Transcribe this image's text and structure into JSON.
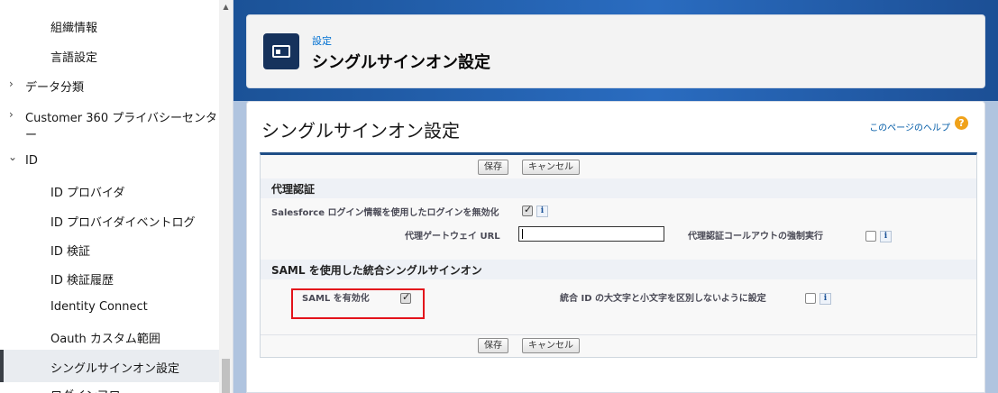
{
  "sidebar": {
    "items": [
      {
        "label": "組織情報"
      },
      {
        "label": "言語設定"
      },
      {
        "label": "データ分類",
        "chevron": "›"
      },
      {
        "label": "Customer 360 プライバシーセンタ",
        "label2": "ー",
        "chevron": "›"
      },
      {
        "label": "ID",
        "chevron": "⌄"
      },
      {
        "label": "ID プロバイダ"
      },
      {
        "label": "ID プロバイダイベントログ"
      },
      {
        "label": "ID 検証"
      },
      {
        "label": "ID 検証履歴"
      },
      {
        "label": "Identity Connect"
      },
      {
        "label": "Oauth カスタム範囲"
      },
      {
        "label": "シングルサインオン設定"
      },
      {
        "label": "ログインフロー"
      }
    ],
    "active_item": "シングルサインオン設定"
  },
  "header": {
    "breadcrumb": "設定",
    "title": "シングルサインオン設定",
    "icon": "id-card-icon"
  },
  "main": {
    "page_title": "シングルサインオン設定",
    "help_link": "このページのヘルプ",
    "help_icon": "?",
    "buttons": {
      "save": "保存",
      "cancel": "キャンセル"
    },
    "delegated": {
      "section_title": "代理認証",
      "disable_login_label": "Salesforce ログイン情報を使用したログインを無効化",
      "disable_login_checked": true,
      "gateway_url_label": "代理ゲートウェイ URL",
      "gateway_url_value": "",
      "force_callout_label": "代理認証コールアウトの強制実行",
      "force_callout_checked": false
    },
    "saml": {
      "section_title": "SAML を使用した統合シングルサインオン",
      "enable_label": "SAML を有効化",
      "enable_checked": true,
      "case_insensitive_label": "統合 ID の大文字と小文字を区別しないように設定",
      "case_insensitive_checked": false
    },
    "info_icon": "i"
  },
  "colors": {
    "highlight_box": "#e3131b",
    "link": "#0070d2",
    "header_band": "#1b5297"
  }
}
